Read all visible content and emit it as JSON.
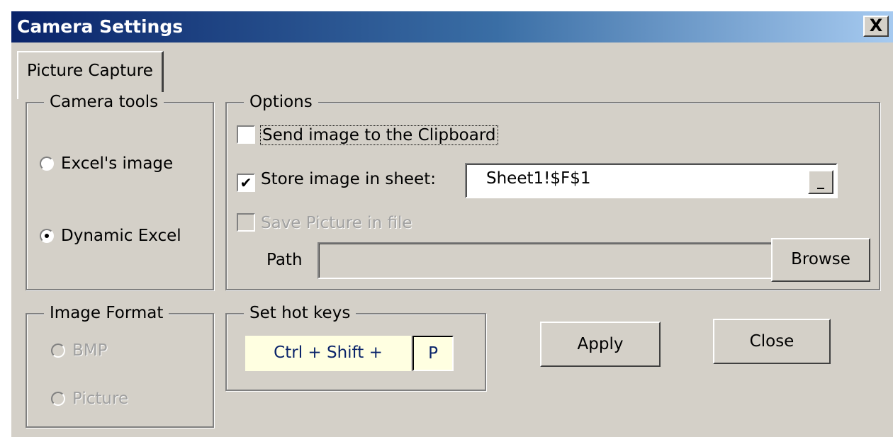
{
  "window": {
    "title": "Camera Settings",
    "close_label": "X"
  },
  "tab": {
    "label": "Picture Capture"
  },
  "camera_tools": {
    "legend": "Camera tools",
    "options": [
      {
        "label": "Excel's image",
        "selected": false
      },
      {
        "label": "Dynamic Excel",
        "selected": true
      }
    ]
  },
  "options": {
    "legend": "Options",
    "send_clipboard": {
      "label": "Send image to the Clipboard",
      "checked": false
    },
    "store_sheet": {
      "label": "Store image in sheet:",
      "checked": true,
      "value": "Sheet1!$F$1",
      "picker_label": "_"
    },
    "save_file": {
      "label": "Save Picture in file",
      "checked": false,
      "enabled": false
    },
    "path": {
      "label": "Path",
      "value": ""
    },
    "browse_label": "Browse"
  },
  "image_format": {
    "legend": "Image Format",
    "options": [
      {
        "label": "BMP",
        "enabled": false
      },
      {
        "label": "Picture",
        "enabled": false
      }
    ]
  },
  "hot_keys": {
    "legend": "Set hot keys",
    "prefix": "Ctrl + Shift +",
    "key": "P"
  },
  "buttons": {
    "apply": "Apply",
    "close": "Close"
  },
  "colors": {
    "title_start": "#0a246a",
    "title_end": "#a6caf0",
    "face": "#d4d0c8",
    "hotkey_bg": "#ffffe1",
    "hotkey_text": "#0a246a"
  }
}
